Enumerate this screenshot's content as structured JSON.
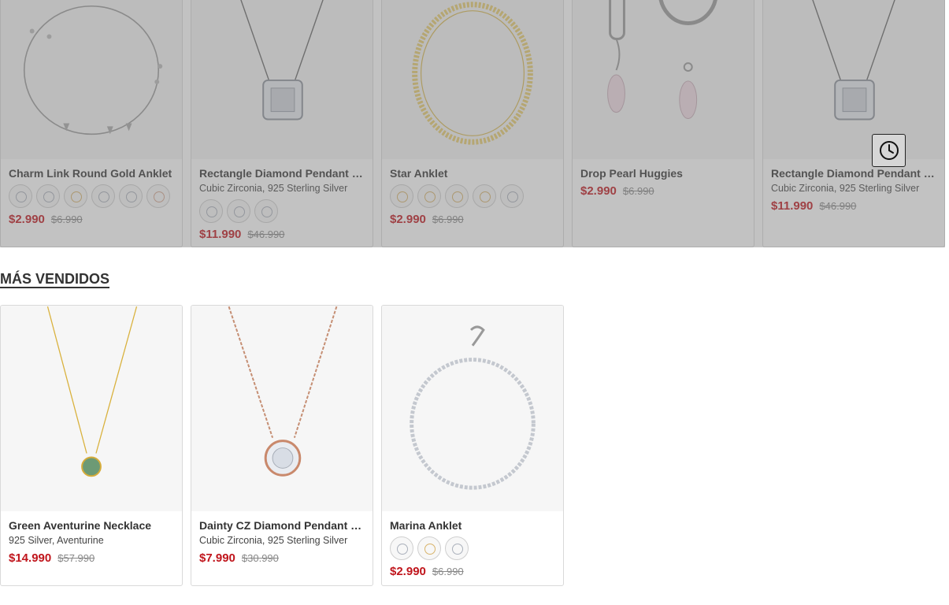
{
  "top_row": [
    {
      "name": "Charm Link Round Gold Anklet",
      "subtitle": "",
      "swatches": [
        "silver",
        "silver",
        "gold",
        "silver",
        "silver",
        "rose",
        "silver"
      ],
      "price": "$2.990",
      "old_price": "$6.990",
      "image": "charm-anklet-image"
    },
    {
      "name": "Rectangle Diamond Pendant Ne...",
      "subtitle": "Cubic Zirconia, 925 Sterling Silver",
      "swatches": [
        "silver",
        "silver",
        "silver"
      ],
      "price": "$11.990",
      "old_price": "$46.990",
      "image": "pendant-necklace-image"
    },
    {
      "name": "Star Anklet",
      "subtitle": "",
      "swatches": [
        "gold",
        "gold",
        "gold",
        "gold",
        "silver"
      ],
      "price": "$2.990",
      "old_price": "$6.990",
      "image": "star-anklet-image"
    },
    {
      "name": "Drop Pearl Huggies",
      "subtitle": "",
      "swatches": [],
      "price": "$2.990",
      "old_price": "$6.990",
      "image": "pearl-huggies-image"
    },
    {
      "name": "Rectangle Diamond Pendant Ne...",
      "subtitle": "Cubic Zirconia, 925 Sterling Silver",
      "swatches": [],
      "price": "$11.990",
      "old_price": "$46.990",
      "image": "pendant-necklace-image"
    }
  ],
  "section": {
    "title": "MÁS VENDIDOS"
  },
  "best_sellers": [
    {
      "name": "Green Aventurine Necklace",
      "subtitle": "925 Silver, Aventurine",
      "swatches": [],
      "price": "$14.990",
      "old_price": "$57.990",
      "image": "aventurine-necklace-image"
    },
    {
      "name": "Dainty CZ Diamond Pendant Ne...",
      "subtitle": "Cubic Zirconia, 925 Sterling Silver",
      "swatches": [],
      "price": "$7.990",
      "old_price": "$30.990",
      "image": "cz-pendant-image"
    },
    {
      "name": "Marina Anklet",
      "subtitle": "",
      "swatches": [
        "silver",
        "gold",
        "silver"
      ],
      "price": "$2.990",
      "old_price": "$6.990",
      "image": "marina-anklet-image"
    }
  ],
  "history_button": {
    "icon": "clock-icon"
  },
  "colors": {
    "price": "#c0151c",
    "old_price": "#888888",
    "overlay": "rgba(120,120,120,0.45)"
  }
}
